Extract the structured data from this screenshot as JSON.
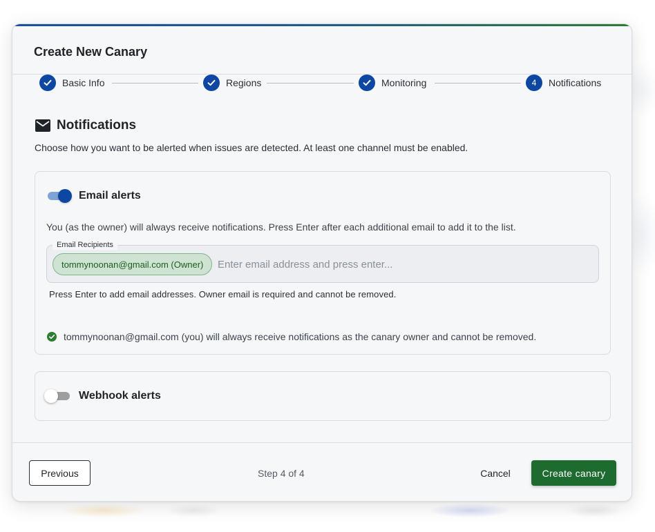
{
  "dialog": {
    "title": "Create New Canary"
  },
  "stepper": {
    "steps": [
      {
        "label": "Basic Info",
        "state": "completed",
        "icon": "check-icon"
      },
      {
        "label": "Regions",
        "state": "completed",
        "icon": "check-icon"
      },
      {
        "label": "Monitoring",
        "state": "completed",
        "icon": "check-icon"
      },
      {
        "label": "Notifications",
        "state": "active",
        "number": "4"
      }
    ]
  },
  "section": {
    "icon": "mail-icon",
    "title": "Notifications",
    "description": "Choose how you want to be alerted when issues are detected. At least one channel must be enabled."
  },
  "email": {
    "toggle_label": "Email alerts",
    "enabled": true,
    "note": "You (as the owner) will always receive notifications. Press Enter after each additional email to add it to the list.",
    "field_label": "Email Recipients",
    "chip": "tommynoonan@gmail.com (Owner)",
    "input_value": "",
    "placeholder": "Enter email address and press enter...",
    "helper": "Press Enter to add email addresses. Owner email is required and cannot be removed.",
    "owner_note": "tommynoonan@gmail.com (you) will always receive notifications as the canary owner and cannot be removed."
  },
  "webhook": {
    "toggle_label": "Webhook alerts",
    "enabled": false
  },
  "footer": {
    "previous_label": "Previous",
    "step_count": "Step 4 of 4",
    "cancel_label": "Cancel",
    "create_label": "Create canary"
  },
  "colors": {
    "primary": "#0d47a1",
    "success": "#1e6b30",
    "chip_bg": "#cfe3d2",
    "check_green": "#2e7d32"
  }
}
